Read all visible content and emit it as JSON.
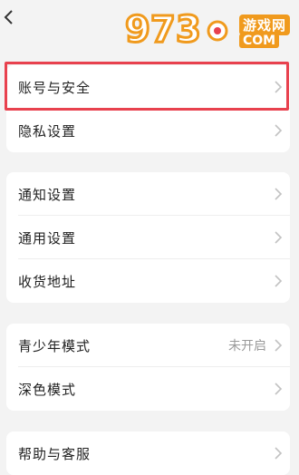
{
  "topbar": {
    "back_icon": "chevron-left-icon",
    "watermark": {
      "chinese": "游戏网",
      "com": "COM"
    }
  },
  "groups": [
    {
      "items": [
        {
          "label": "账号与安全",
          "value": "",
          "icon": "chevron-right-icon",
          "highlighted": true
        },
        {
          "label": "隐私设置",
          "value": "",
          "icon": "chevron-right-icon"
        }
      ]
    },
    {
      "items": [
        {
          "label": "通知设置",
          "value": "",
          "icon": "chevron-right-icon"
        },
        {
          "label": "通用设置",
          "value": "",
          "icon": "chevron-right-icon"
        },
        {
          "label": "收货地址",
          "value": "",
          "icon": "chevron-right-icon"
        }
      ]
    },
    {
      "items": [
        {
          "label": "青少年模式",
          "value": "未开启",
          "icon": "chevron-right-icon"
        },
        {
          "label": "深色模式",
          "value": "",
          "icon": "chevron-right-icon"
        }
      ]
    },
    {
      "items": [
        {
          "label": "帮助与客服",
          "value": "",
          "icon": "chevron-right-icon"
        }
      ]
    }
  ],
  "colors": {
    "background": "#f3f3f3",
    "card": "#ffffff",
    "highlight_border": "#e8414e",
    "watermark": "#f09a1d"
  }
}
